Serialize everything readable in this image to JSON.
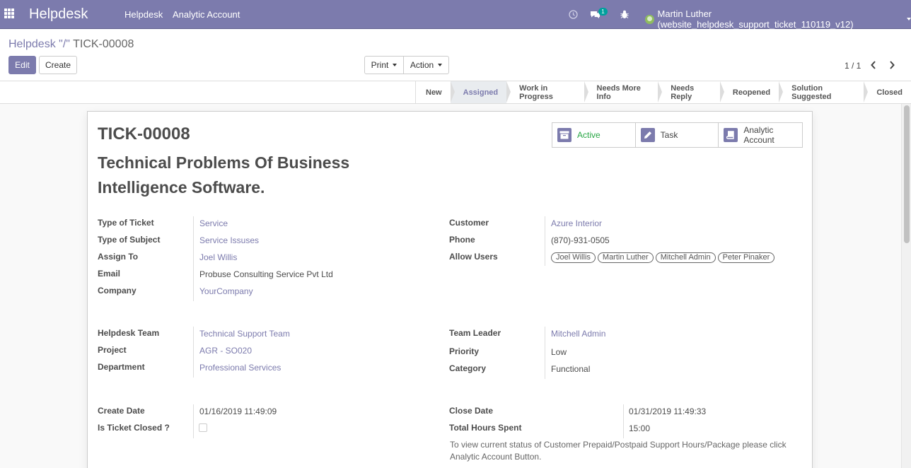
{
  "navbar": {
    "brand": "Helpdesk",
    "menu": [
      "Helpdesk",
      "Analytic Account"
    ],
    "messages_count": "1",
    "user": "Martin Luther (website_helpdesk_support_ticket_110119_v12)"
  },
  "control": {
    "breadcrumb_link": "Helpdesk \"/\"",
    "breadcrumb_active": "TICK-00008",
    "edit_label": "Edit",
    "create_label": "Create",
    "print_label": "Print",
    "action_label": "Action",
    "pager": "1 / 1"
  },
  "stages": [
    "New",
    "Assigned",
    "Work in Progress",
    "Needs More Info",
    "Needs Reply",
    "Reopened",
    "Solution Suggested",
    "Closed"
  ],
  "active_stage": "Assigned",
  "smart_buttons": {
    "active": "Active",
    "task": "Task",
    "analytic_line1": "Analytic",
    "analytic_line2": "Account"
  },
  "ticket": {
    "number": "TICK-00008",
    "title_line1": "Technical Problems Of Business",
    "title_line2": "Intelligence Software."
  },
  "left_group1": [
    {
      "label": "Type of Ticket",
      "value": "Service"
    },
    {
      "label": "Type of Subject",
      "value": "Service Issuses"
    },
    {
      "label": "Assign To",
      "value": "Joel Willis"
    },
    {
      "label": "Email",
      "value": "Probuse Consulting Service Pvt Ltd"
    },
    {
      "label": "Company",
      "value": "YourCompany"
    }
  ],
  "right_group1": {
    "customer_label": "Customer",
    "customer": "Azure Interior",
    "phone_label": "Phone",
    "phone": "(870)-931-0505",
    "allow_users_label": "Allow Users",
    "allow_users": [
      "Joel Willis",
      "Martin Luther",
      "Mitchell Admin",
      "Peter Pinaker"
    ]
  },
  "left_group2": [
    {
      "label": "Helpdesk Team",
      "value": "Technical Support Team"
    },
    {
      "label": "Project",
      "value": "AGR - SO020"
    },
    {
      "label": "Department",
      "value": "Professional Services"
    }
  ],
  "right_group2": [
    {
      "label": "Team Leader",
      "value": "Mitchell Admin"
    },
    {
      "label": "Priority",
      "value": "Low"
    },
    {
      "label": "Category",
      "value": "Functional"
    }
  ],
  "left_group3": {
    "create_date_label": "Create Date",
    "create_date": "01/16/2019 11:49:09",
    "closed_label": "Is Ticket Closed ?",
    "is_closed": false
  },
  "right_group3": {
    "close_date_label": "Close Date",
    "close_date": "01/31/2019 11:49:33",
    "hours_label": "Total Hours Spent",
    "hours": "15:00",
    "note_line1": "To view current status of Customer Prepaid/Postpaid Support Hours/Package please click",
    "note_line2": "Analytic Account Button."
  },
  "colors": {
    "primary": "#7c7bad",
    "active_green": "#28a745"
  }
}
